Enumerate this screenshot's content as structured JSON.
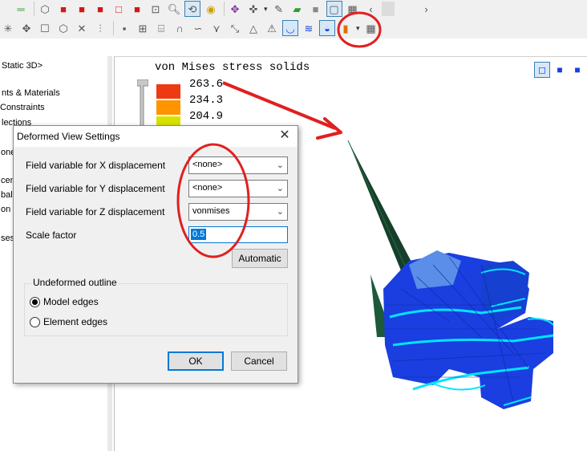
{
  "colors": {
    "accent": "#0078d7",
    "annotation_red": "#e02020",
    "model_blue": "#1a3ee0",
    "model_edge": "#00e5ff",
    "legend": [
      "#ee3a12",
      "#ff9400",
      "#d6e300"
    ]
  },
  "toolbar": {
    "row1_icons": [
      "equals-icon",
      "cube-wire-icon",
      "cube-red-icon",
      "cube-red-2-icon",
      "cube-red-3-icon",
      "cube-red-4-icon",
      "cube-red-5-icon",
      "zoom-box-icon",
      "zoom-icon",
      "rotate-icon",
      "spin-icon",
      "pan-icon",
      "dropdown-icon",
      "pencil-icon",
      "plane-icon",
      "shaded-cube-icon",
      "wire-cube-icon",
      "mesh-cube-icon",
      "scroll-left-icon",
      "scroll-right-icon"
    ],
    "row2_icons": [
      "sparkle-icon",
      "move-icon",
      "square-icon",
      "box-icon",
      "cross-icon",
      "split-icon",
      "node-icon",
      "element-icon",
      "cylinder-icon",
      "arch-icon",
      "curve-icon",
      "branch-icon",
      "arrow-icon",
      "triangle-icon",
      "warning-icon",
      "deformed-icon",
      "contour-icon",
      "deformed-view-icon",
      "legend-icon",
      "table-icon"
    ]
  },
  "tree": {
    "items": [
      "Static 3D>",
      "nts & Materials",
      "Constraints",
      "lections",
      "one",
      "cen",
      "bal",
      "on f",
      "ses"
    ]
  },
  "viewport": {
    "title": "von Mises stress solids",
    "legend": [
      {
        "value": "263.6"
      },
      {
        "value": "234.3"
      },
      {
        "value": "204.9"
      }
    ],
    "view_buttons": [
      "view-front-icon",
      "view-iso-icon",
      "view-solid-icon"
    ]
  },
  "dialog": {
    "title": "Deformed View Settings",
    "close": "✕",
    "fields": [
      {
        "label": "Field variable for X displacement",
        "value": "<none>"
      },
      {
        "label": "Field variable for Y displacement",
        "value": "<none>"
      },
      {
        "label": "Field variable for Z displacement",
        "value": "vonmises"
      }
    ],
    "scale_label": "Scale factor",
    "scale_value": "0.5",
    "automatic": "Automatic",
    "group_title": "Undeformed outline",
    "radio_model": "Model edges",
    "radio_element": "Element edges",
    "radio_selected": "Model edges",
    "ok": "OK",
    "cancel": "Cancel"
  }
}
